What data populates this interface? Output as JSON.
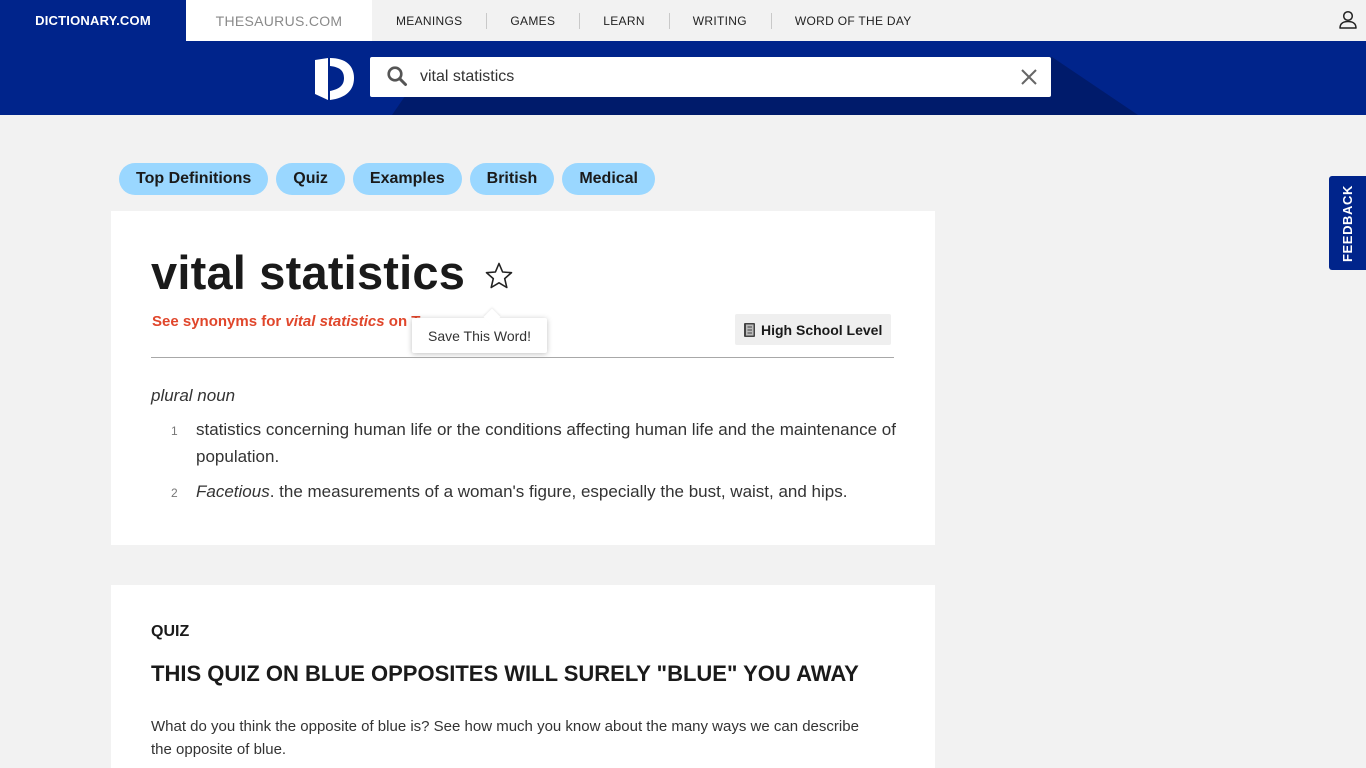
{
  "nav": {
    "dictionary_tab": "DICTIONARY.COM",
    "thesaurus_tab": "THESAURUS.COM",
    "links": [
      "MEANINGS",
      "GAMES",
      "LEARN",
      "WRITING",
      "WORD OF THE DAY"
    ]
  },
  "search": {
    "value": "vital statistics"
  },
  "pills": [
    "Top Definitions",
    "Quiz",
    "Examples",
    "British",
    "Medical"
  ],
  "feedback_label": "FEEDBACK",
  "entry": {
    "headword": "vital statistics",
    "synonyms_prefix": "See synonyms for ",
    "synonyms_term": "vital statistics",
    "synonyms_suffix": " o",
    "synonyms_cut": "n T",
    "tooltip": "Save This Word!",
    "level": "High School Level",
    "part_of_speech": "plural noun",
    "definitions": [
      {
        "num": "1",
        "text": "statistics concerning human life or the conditions affecting human life and the maintenance of population."
      },
      {
        "num": "2",
        "label": "Facetious",
        "text": ". the measurements of a woman's figure, especially the bust, waist, and hips."
      }
    ]
  },
  "quiz": {
    "label": "QUIZ",
    "title": "THIS QUIZ ON BLUE OPPOSITES WILL SURELY \"BLUE\" YOU AWAY",
    "description": "What do you think the opposite of blue is? See how much you know about the many ways we can describe the opposite of blue."
  },
  "colors": {
    "brand_blue": "#00248b",
    "pill_blue": "#9ad7ff",
    "synonym_orange": "#e0462b"
  }
}
